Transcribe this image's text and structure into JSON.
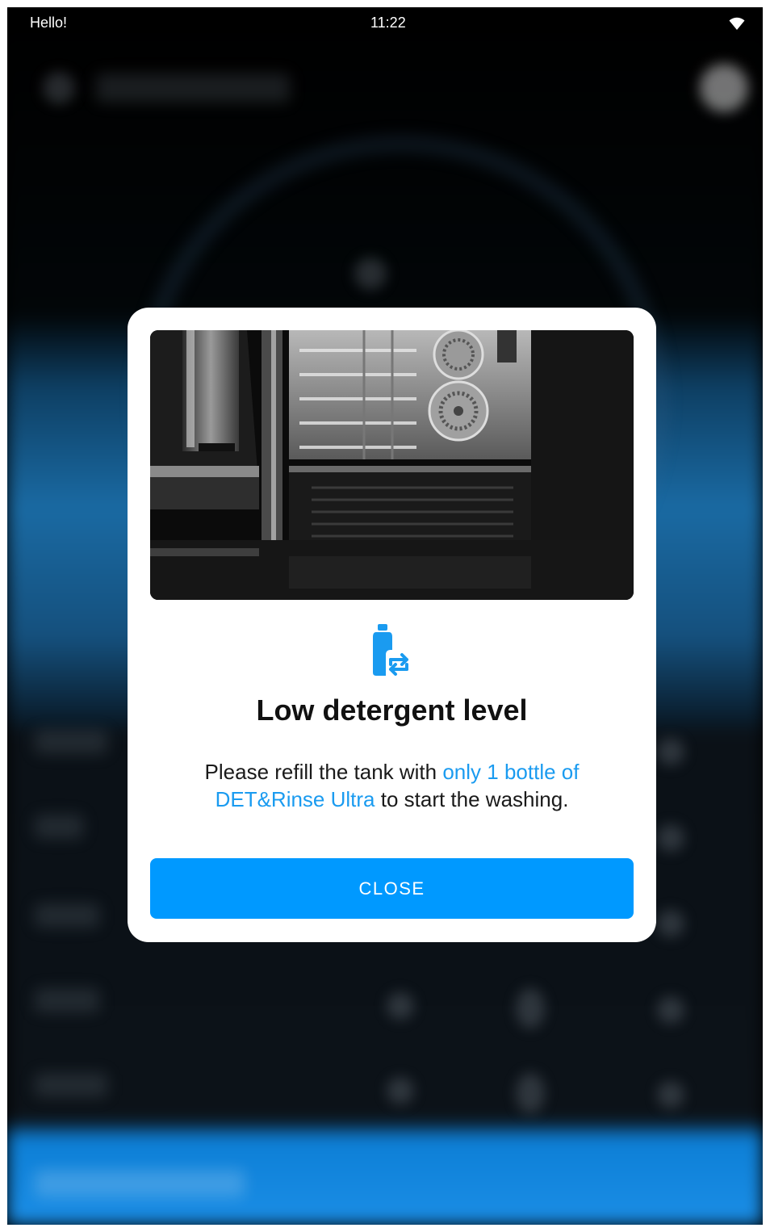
{
  "status_bar": {
    "greeting": "Hello!",
    "time": "11:22",
    "wifi_icon": "wifi-icon"
  },
  "dialog": {
    "image": "oven-interior-photo",
    "icon": "detergent-bottle-refill-icon",
    "title": "Low detergent level",
    "message_part1": "Please refill the tank with ",
    "message_highlight": "only 1 bottle of DET&Rinse Ultra",
    "message_part2": " to start the washing.",
    "close_label": "CLOSE"
  },
  "colors": {
    "accent": "#0099ff",
    "highlight_text": "#1a9bf0",
    "dialog_background": "#ffffff",
    "title_text": "#111111"
  }
}
